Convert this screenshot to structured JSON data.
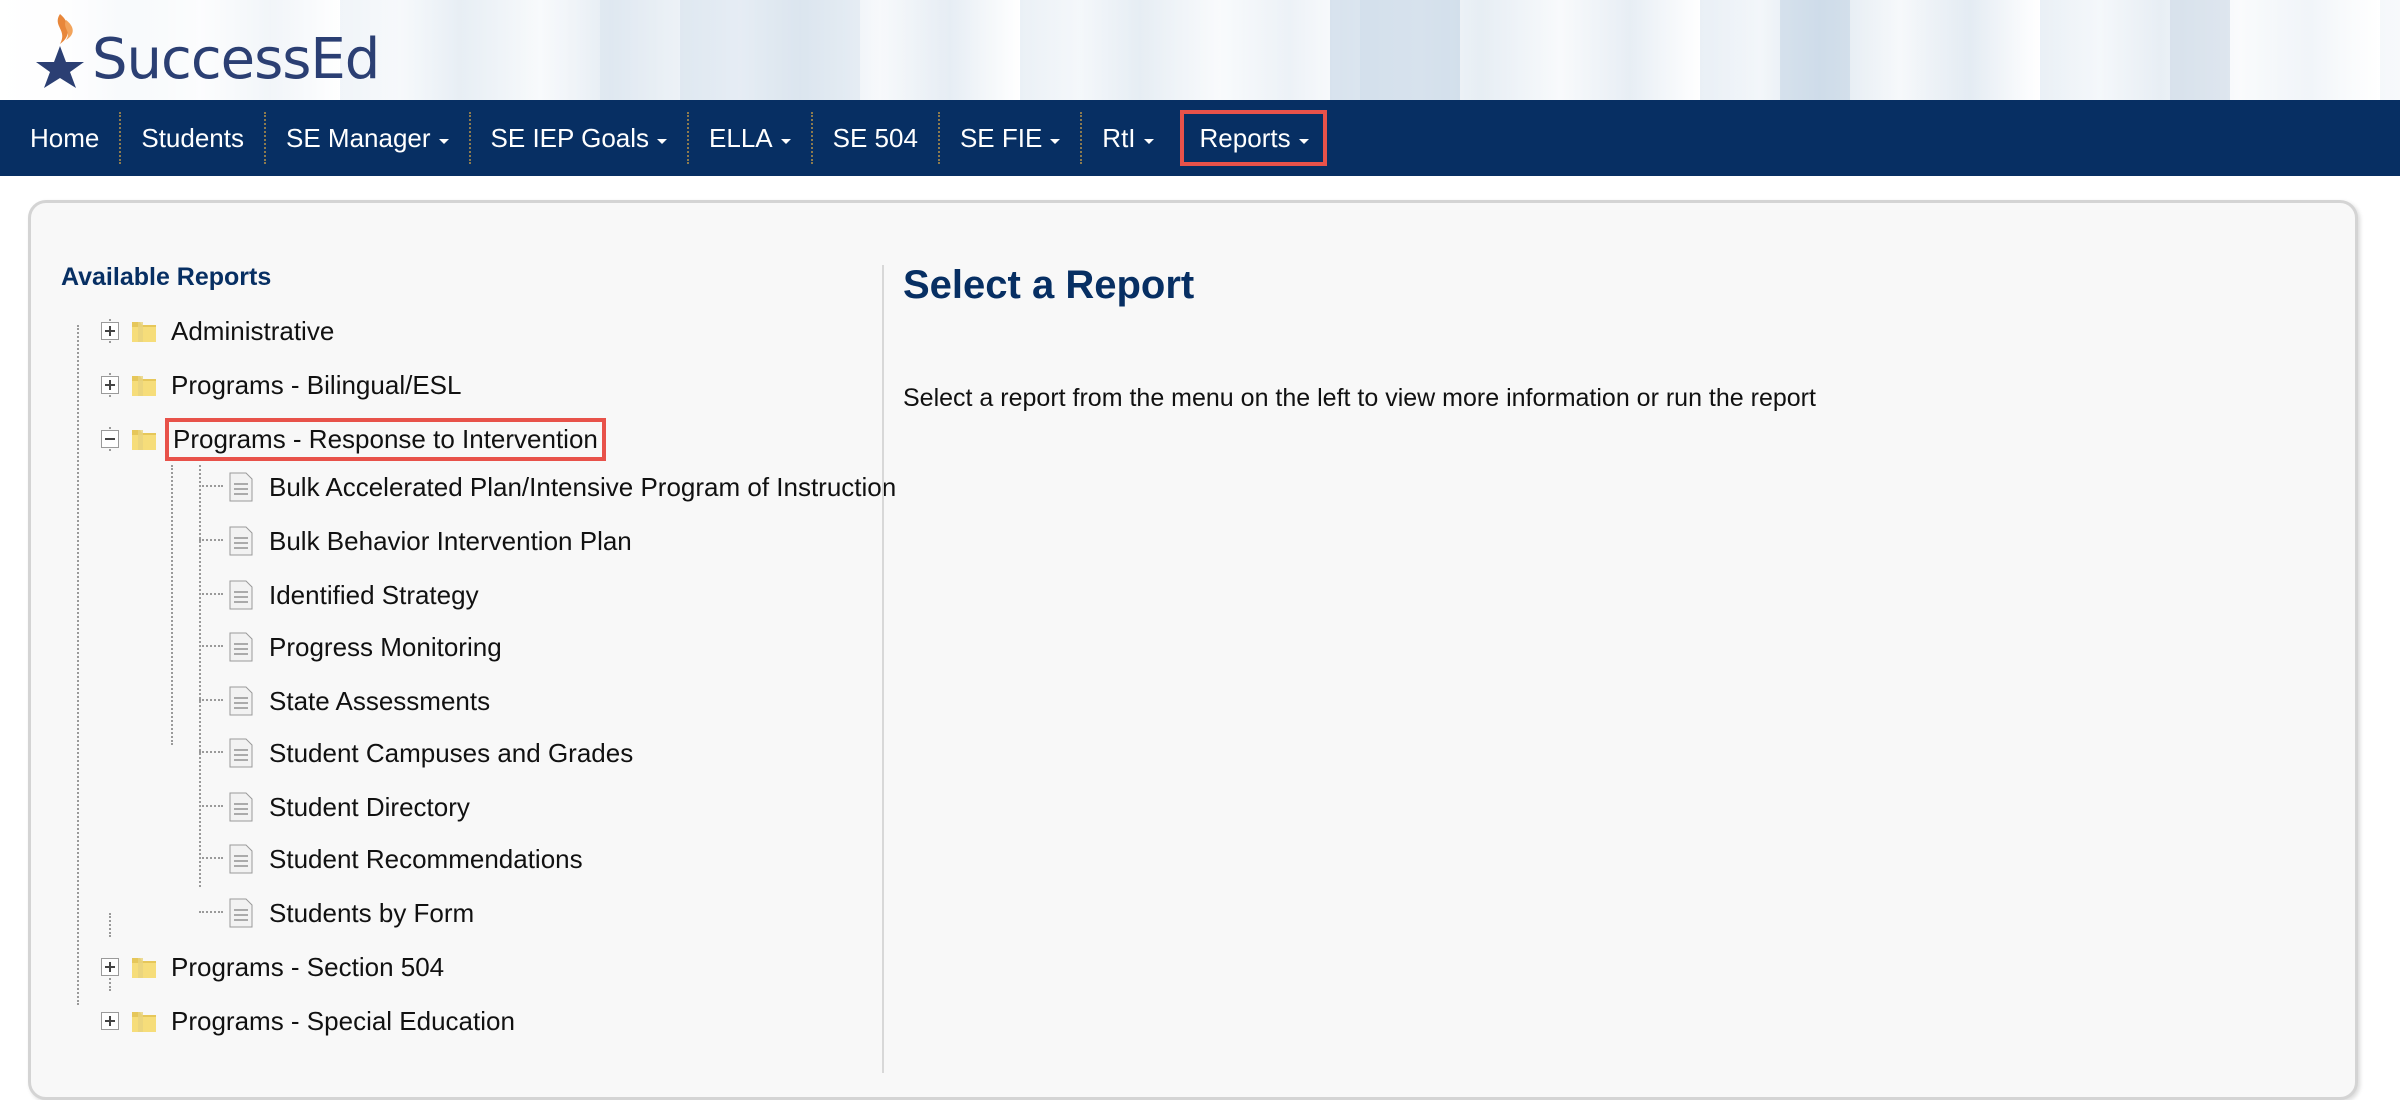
{
  "app": {
    "logo_text": "SuccessEd"
  },
  "nav": {
    "items": [
      {
        "label": "Home",
        "dropdown": false
      },
      {
        "label": "Students",
        "dropdown": false
      },
      {
        "label": "SE Manager",
        "dropdown": true
      },
      {
        "label": "SE IEP Goals",
        "dropdown": true
      },
      {
        "label": "ELLA",
        "dropdown": true
      },
      {
        "label": "SE 504",
        "dropdown": false
      },
      {
        "label": "SE FIE",
        "dropdown": true
      },
      {
        "label": "RtI",
        "dropdown": true
      },
      {
        "label": "Reports",
        "dropdown": true
      }
    ]
  },
  "sidebar": {
    "title": "Available Reports",
    "folders": [
      {
        "label": "Administrative",
        "expanded": false
      },
      {
        "label": "Programs - Bilingual/ESL",
        "expanded": false
      },
      {
        "label": "Programs - Response to Intervention",
        "expanded": true,
        "reports": [
          "Bulk Accelerated Plan/Intensive Program of Instruction",
          "Bulk Behavior Intervention Plan",
          "Identified Strategy",
          "Progress Monitoring",
          "State Assessments",
          "Student Campuses and Grades",
          "Student Directory",
          "Student Recommendations",
          "Students by Form"
        ]
      },
      {
        "label": "Programs - Section 504",
        "expanded": false
      },
      {
        "label": "Programs - Special Education",
        "expanded": false
      }
    ]
  },
  "main": {
    "title": "Select a Report",
    "description": "Select a report from the menu on the left to view more information or run the report"
  },
  "colors": {
    "nav_bg": "#072f63",
    "title": "#072f63",
    "highlight": "#e8524a",
    "logo_flame": "#e8873a",
    "logo_star": "#2b3f73"
  },
  "icons": {
    "folder": "folder-icon",
    "report": "document-icon",
    "expand": "plus-box-icon",
    "collapse": "minus-box-icon"
  }
}
